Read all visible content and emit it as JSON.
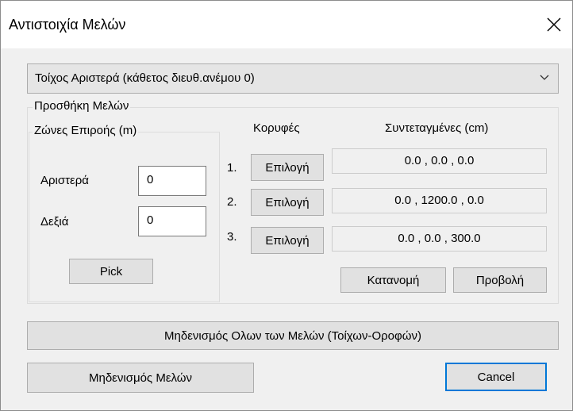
{
  "window": {
    "title": "Αντιστοιχία Μελών"
  },
  "combo": {
    "selected": "Τοίχος Αριστερά (κάθετος διευθ.ανέμου 0)"
  },
  "group": {
    "label": "Προσθήκη Μελών"
  },
  "zones": {
    "label": "Ζώνες Επιροής (m)",
    "left_label": "Αριστερά",
    "left_value": "0",
    "right_label": "Δεξιά",
    "right_value": "0",
    "pick_label": "Pick"
  },
  "vertices": {
    "header_vertices": "Κορυφές",
    "header_coords": "Συντεταγμένες (cm)",
    "rows": [
      {
        "num": "1.",
        "button": "Επιλογή",
        "coords": "0.0 , 0.0 , 0.0"
      },
      {
        "num": "2.",
        "button": "Επιλογή",
        "coords": "0.0 , 1200.0 , 0.0"
      },
      {
        "num": "3.",
        "button": "Επιλογή",
        "coords": "0.0 , 0.0 , 300.0"
      }
    ],
    "distribute_label": "Κατανομή",
    "view_label": "Προβολή"
  },
  "buttons": {
    "reset_all": "Μηδενισμός Ολων των Μελών (Τοίχων-Οροφών)",
    "reset_members": "Μηδενισμός Μελών",
    "cancel": "Cancel"
  }
}
